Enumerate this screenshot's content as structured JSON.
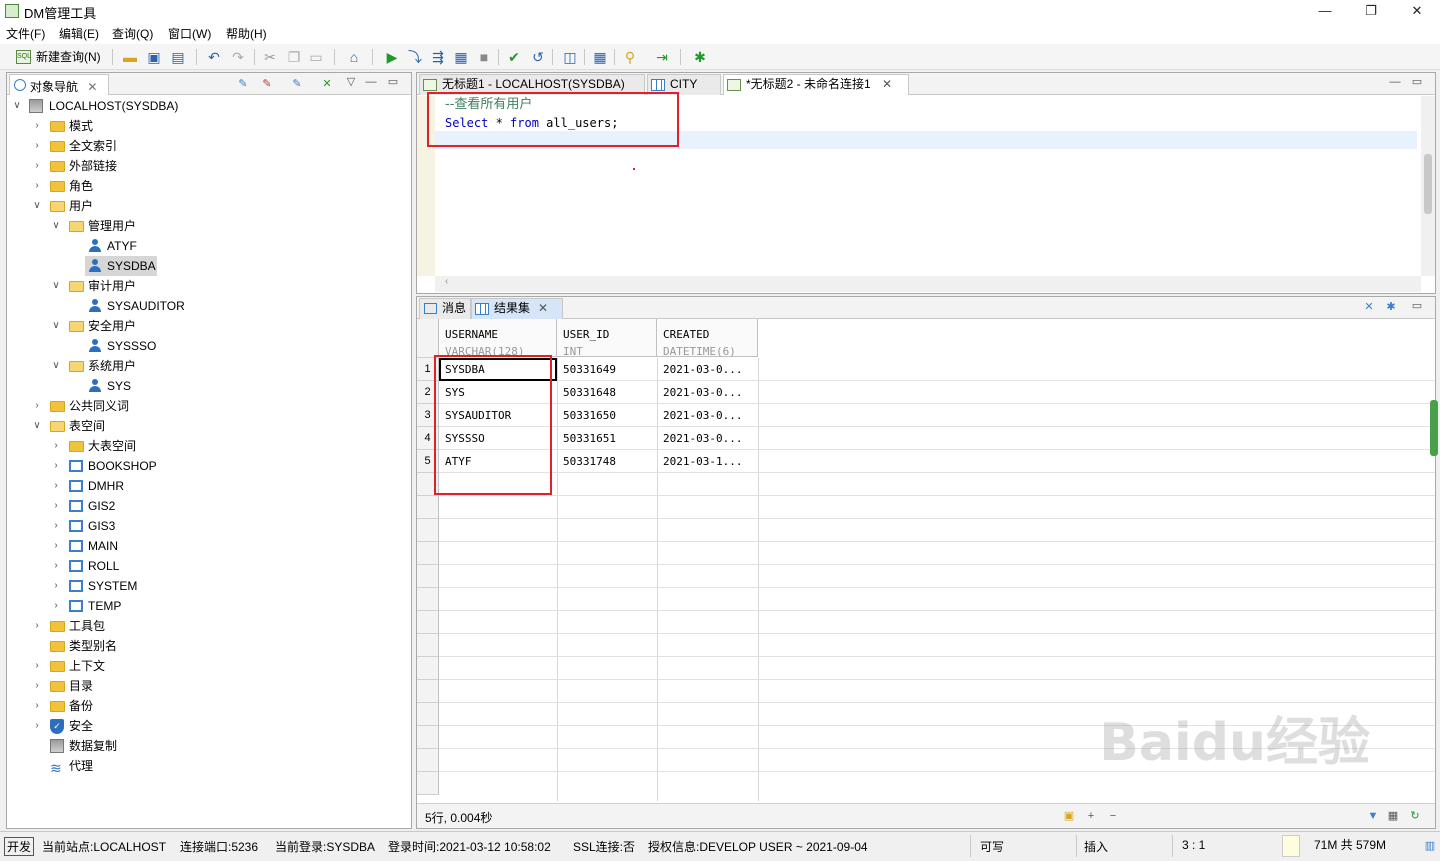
{
  "window": {
    "title": "DM管理工具",
    "minimize": "—",
    "restore": "❐",
    "close": "✕"
  },
  "menu": [
    "文件(F)",
    "编辑(E)",
    "查询(Q)",
    "窗口(W)",
    "帮助(H)"
  ],
  "toolbar": {
    "new_query": "新建查询(N)",
    "sql_icon_text": "SQL"
  },
  "navigator": {
    "tab_label": "对象导航",
    "root": "LOCALHOST(SYSDBA)",
    "items": {
      "schema": "模式",
      "fulltext": "全文索引",
      "dblink": "外部链接",
      "role": "角色",
      "user": "用户",
      "admin_users": "管理用户",
      "atyf": "ATYF",
      "sysdba": "SYSDBA",
      "audit_users": "审计用户",
      "sysauditor": "SYSAUDITOR",
      "security_users": "安全用户",
      "syssso": "SYSSSO",
      "system_users": "系统用户",
      "sys": "SYS",
      "public_synonym": "公共同义词",
      "tablespace": "表空间",
      "big_tablespace": "大表空间",
      "bookshop": "BOOKSHOP",
      "dmhr": "DMHR",
      "gis2": "GIS2",
      "gis3": "GIS3",
      "main": "MAIN",
      "roll": "ROLL",
      "system": "SYSTEM",
      "temp": "TEMP",
      "toolkit": "工具包",
      "type_alias": "类型别名",
      "context": "上下文",
      "directory": "目录",
      "backup": "备份",
      "security": "安全",
      "replication": "数据复制",
      "proxy": "代理"
    }
  },
  "editor": {
    "tabs": [
      "无标题1 - LOCALHOST(SYSDBA)",
      "CITY",
      "*无标题2 - 未命名连接1"
    ],
    "comment": "--查看所有用户",
    "kw_select": "Select",
    "star": " * ",
    "kw_from": "from",
    "rest": " all_users;"
  },
  "results": {
    "tabs": [
      "消息",
      "结果集"
    ],
    "columns": [
      {
        "name": "USERNAME",
        "type": "VARCHAR(128)"
      },
      {
        "name": "USER_ID",
        "type": "INT"
      },
      {
        "name": "CREATED",
        "type": "DATETIME(6)"
      }
    ],
    "rows": [
      [
        "SYSDBA",
        "50331649",
        "2021-03-0..."
      ],
      [
        "SYS",
        "50331648",
        "2021-03-0..."
      ],
      [
        "SYSAUDITOR",
        "50331650",
        "2021-03-0..."
      ],
      [
        "SYSSSO",
        "50331651",
        "2021-03-0..."
      ],
      [
        "ATYF",
        "50331748",
        "2021-03-1..."
      ]
    ],
    "row_numbers": [
      "1",
      "2",
      "3",
      "4",
      "5"
    ],
    "status": "5行, 0.004秒"
  },
  "statusbar": {
    "mode": "开发",
    "site": "当前站点:LOCALHOST",
    "port": "连接端口:5236",
    "login": "当前登录:SYSDBA",
    "login_time": "登录时间:2021-03-12 10:58:02",
    "ssl": "SSL连接:否",
    "license": "授权信息:DEVELOP USER ~ 2021-09-04",
    "writable": "可写",
    "insert": "插入",
    "cursor": "3 : 1",
    "memory": "71M 共 579M"
  },
  "watermark": "Baidu经验",
  "colors": {
    "highlight_box": "#e0202a",
    "keyword": "#0000c0",
    "comment": "#3f7f5f"
  }
}
